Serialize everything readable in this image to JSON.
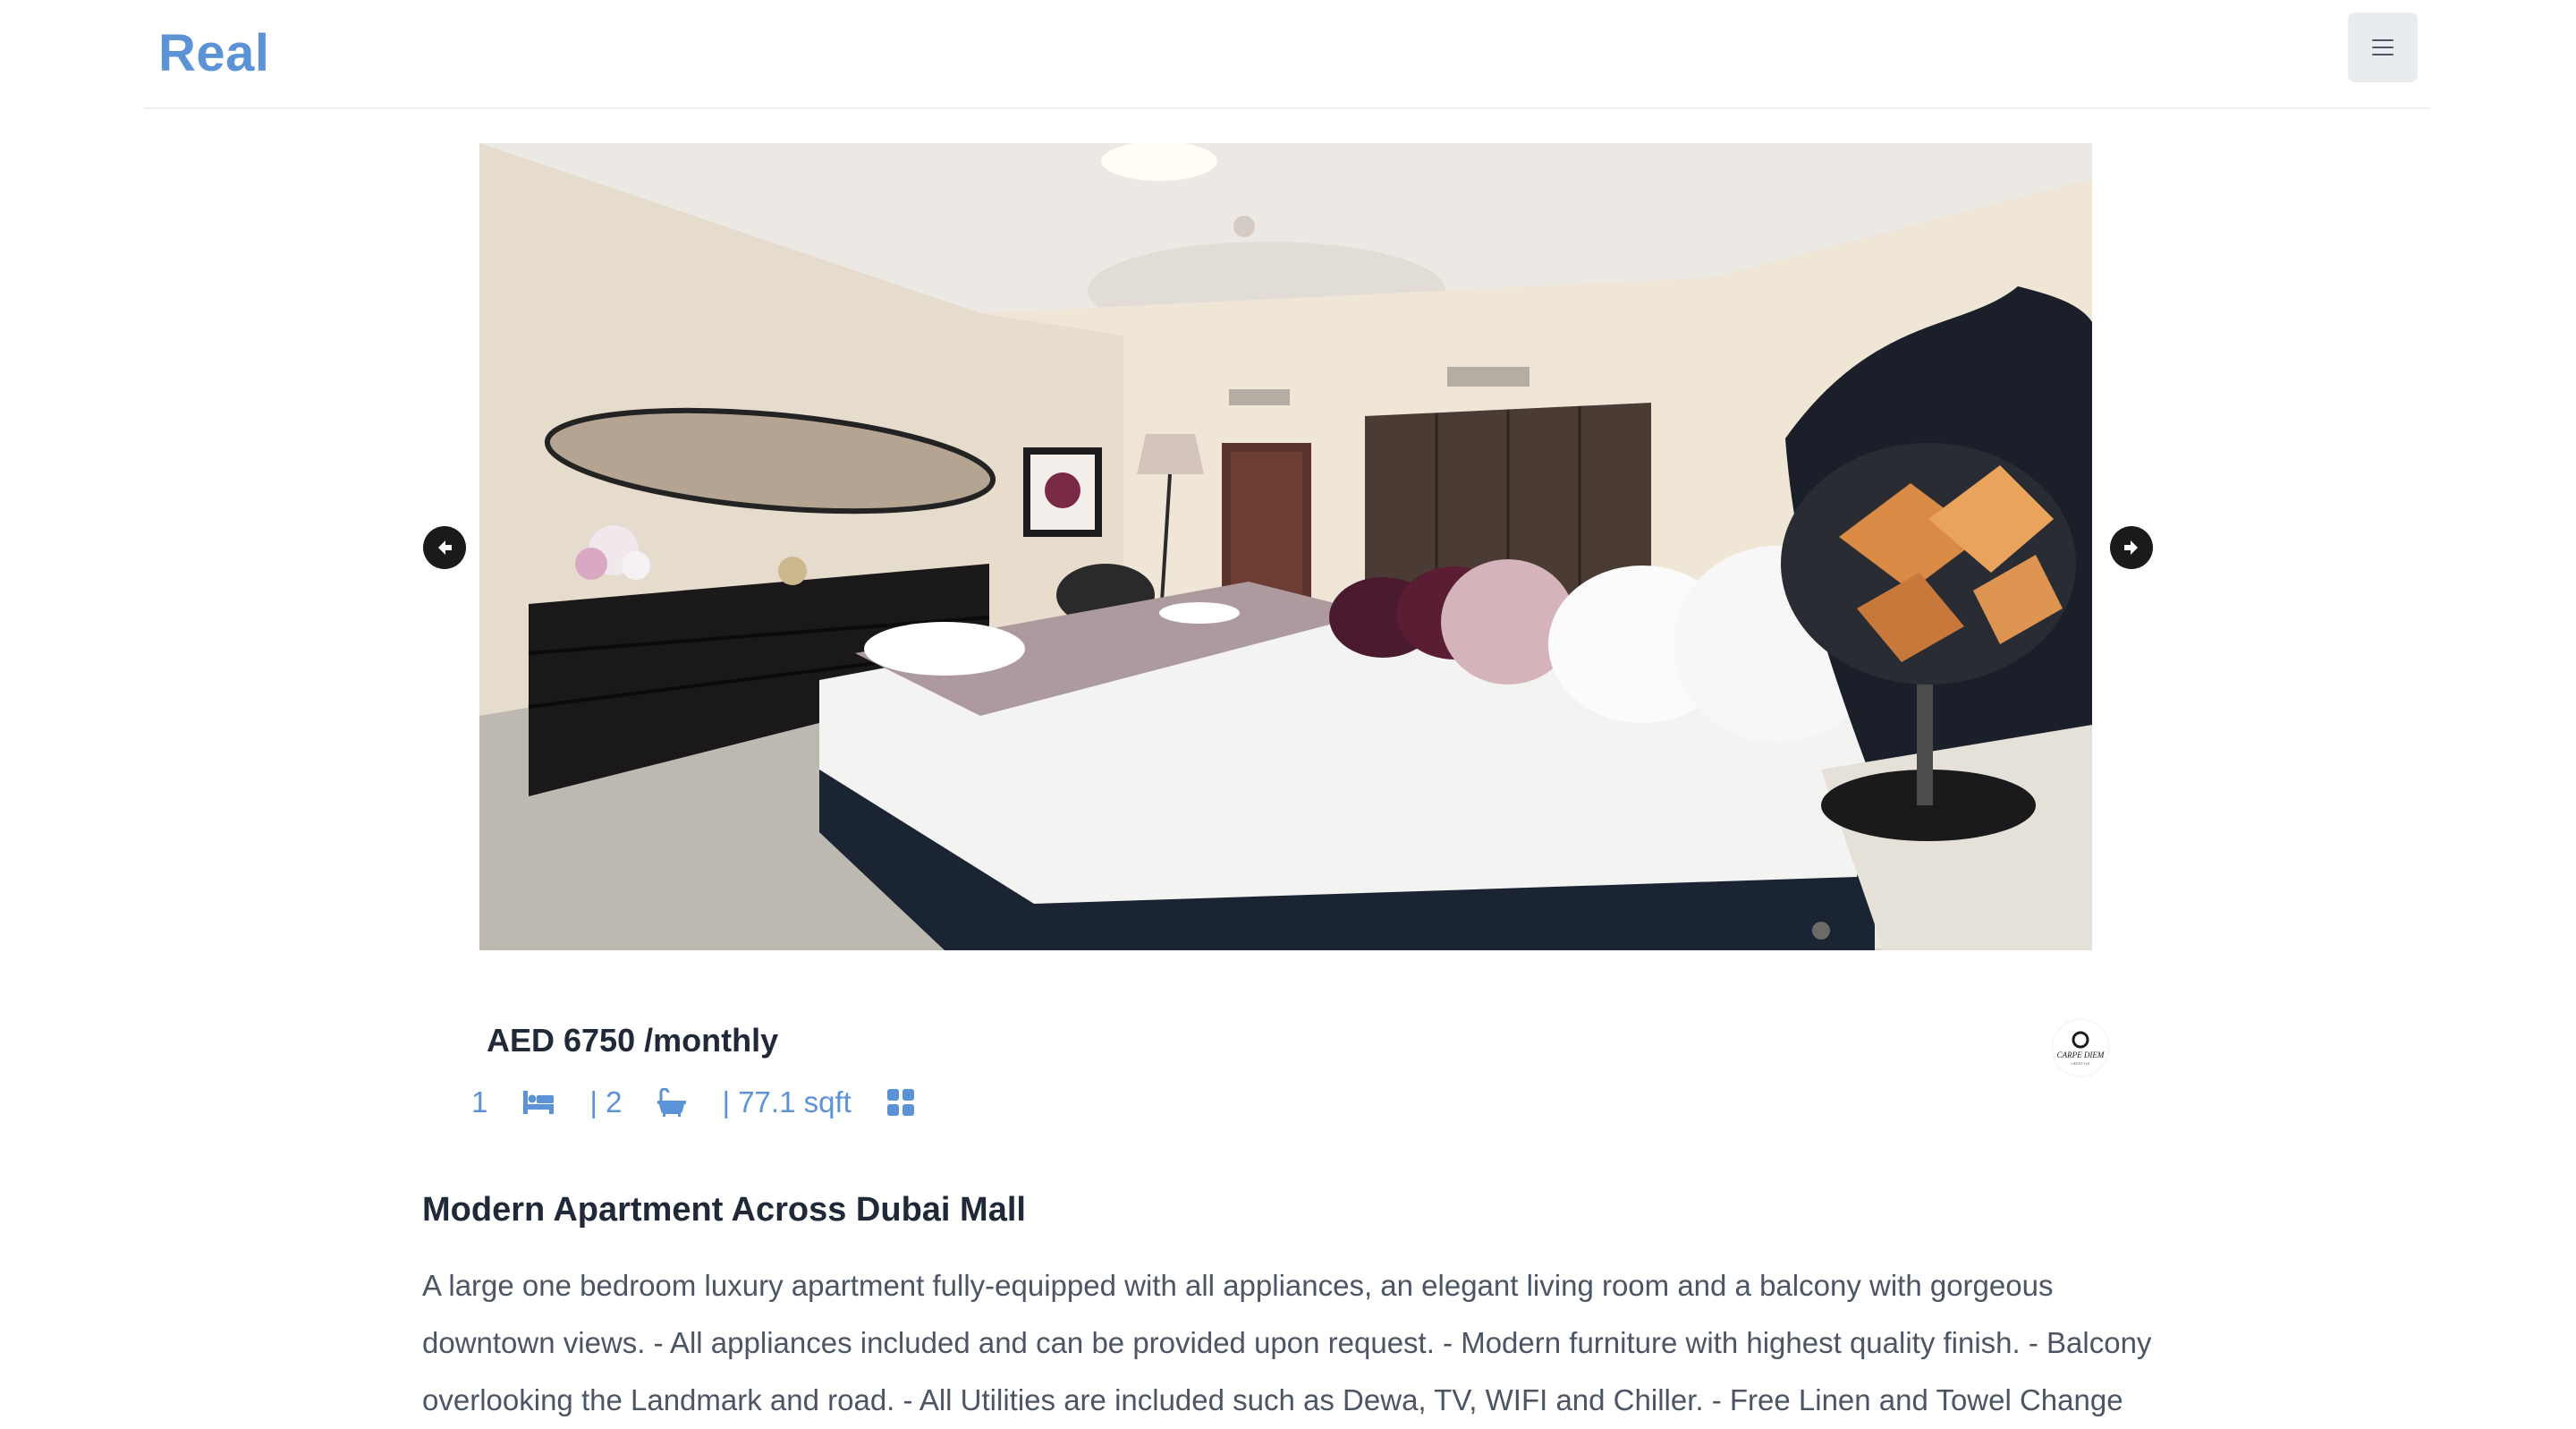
{
  "header": {
    "logo": "Real",
    "menu_icon": "hamburger-menu-icon"
  },
  "carousel": {
    "prev_icon": "arrow-left-circle-icon",
    "next_icon": "arrow-right-circle-icon",
    "image_alt": "Bedroom with white bed, dark velvet headboard, oval mirror and geometric copper table lamp"
  },
  "listing": {
    "price": "AED 6750 /monthly",
    "bedrooms": "1",
    "bathrooms": "| 2",
    "area": "| 77.1 sqft",
    "bed_icon": "bed-icon",
    "bath_icon": "bathtub-icon",
    "area_icon": "grid-icon",
    "agency_logo_text": "CARPE DIEM",
    "agency_logo_subtext": "LIFESTYLE",
    "title": "Modern Apartment Across Dubai Mall",
    "description": "A large one bedroom luxury apartment fully-equipped with all appliances, an elegant living room and a balcony with gorgeous downtown views. - All appliances included and can be provided upon request. - Modern furniture with highest quality finish. - Balcony overlooking the Landmark and road. - All Utilities are included such as Dewa, TV, WIFI and Chiller. - Free Linen and Towel Change"
  },
  "colors": {
    "accent": "#5b93d6",
    "text": "#1f2937",
    "muted": "#4b5563"
  }
}
